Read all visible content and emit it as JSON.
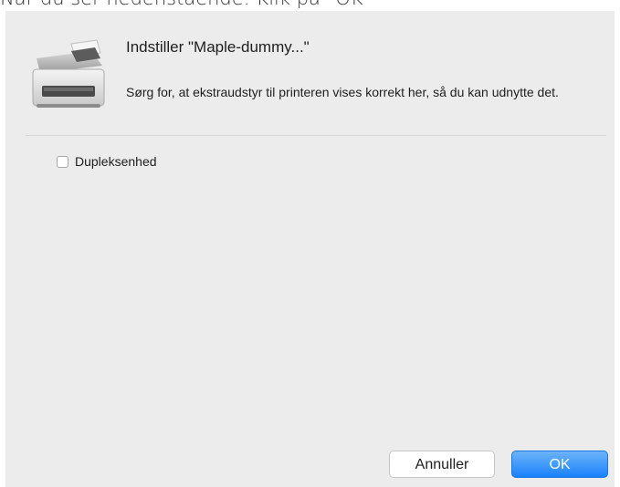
{
  "caption": {
    "text": "Når du ser nedenstående: Klik på \"OK\""
  },
  "dialog": {
    "title": "Indstiller \"Maple-dummy...\"",
    "message": "Sørg for, at ekstraudstyr til printeren vises korrekt her, så du kan udnytte det.",
    "options": [
      {
        "label": "Dupleksenhed",
        "checked": false
      }
    ],
    "buttons": {
      "cancel_label": "Annuller",
      "ok_label": "OK"
    },
    "icon": "printer-icon",
    "colors": {
      "accent": "#1a82fb",
      "background": "#ececec"
    }
  }
}
